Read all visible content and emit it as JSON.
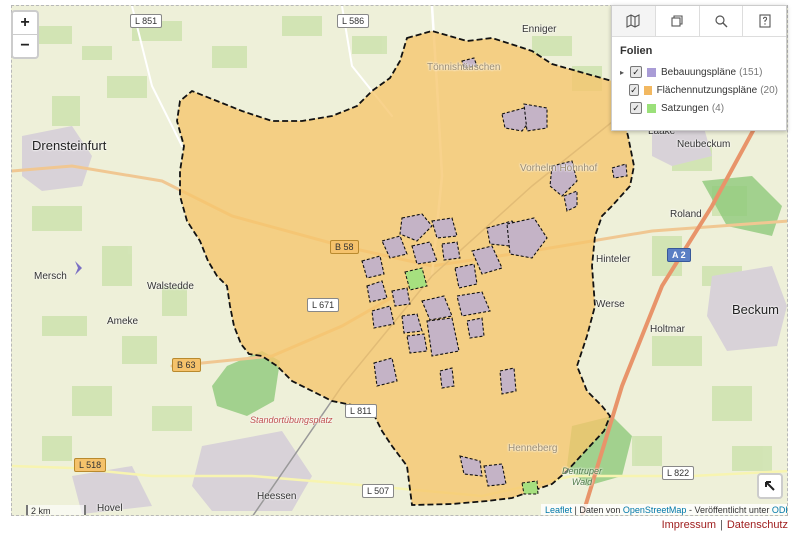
{
  "map": {
    "zoom_in": "+",
    "zoom_out": "−",
    "scale": "2 km",
    "place_labels": {
      "drensteinfurt": "Drensteinfurt",
      "mersch": "Mersch",
      "walstedde": "Walstedde",
      "ameke": "Ameke",
      "hovel": "Hovel",
      "heessen": "Heessen",
      "beckum": "Beckum",
      "neubeckum": "Neubeckum",
      "enniger": "Enniger",
      "roland": "Roland",
      "hinteler": "Hinteler",
      "werse": "Werse",
      "holtmar": "Holtmar",
      "henneberg": "Henneberg",
      "laake": "Laake",
      "tonnishauschen": "Tönnishäuschen",
      "vorhelm": "Vorhelm Hohnhof",
      "standortuebungsplatz": "Standortübungsplatz",
      "geisterholz": "Dentruper Wald"
    },
    "road_labels": {
      "l851": "L 851",
      "l586": "L 586",
      "l671": "L 671",
      "b63": "B 63",
      "b58": "B 58",
      "l518": "L 518",
      "l811": "L 811",
      "l507": "L 507",
      "l822": "L 822",
      "a2": "A 2"
    }
  },
  "layer_panel": {
    "tabs": [
      "map",
      "layers",
      "search",
      "help"
    ],
    "heading": "Folien",
    "layers": [
      {
        "name": "Bebauungspläne",
        "count": "(151)",
        "checked": true,
        "expandable": true,
        "color": "#a99cd6"
      },
      {
        "name": "Flächennutzungspläne",
        "count": "(20)",
        "checked": true,
        "expandable": false,
        "color": "#f2b861"
      },
      {
        "name": "Satzungen",
        "count": "(4)",
        "checked": true,
        "expandable": false,
        "color": "#9be07a"
      }
    ]
  },
  "attribution": {
    "leaflet": "Leaflet",
    "sep1": " | Daten von ",
    "osm": "OpenStreetMap",
    "sep2": " - Veröffentlicht unter ",
    "odbl": "ODbL"
  },
  "footer": {
    "impressum": "Impressum",
    "separator": "|",
    "datenschutz": "Datenschutz"
  }
}
